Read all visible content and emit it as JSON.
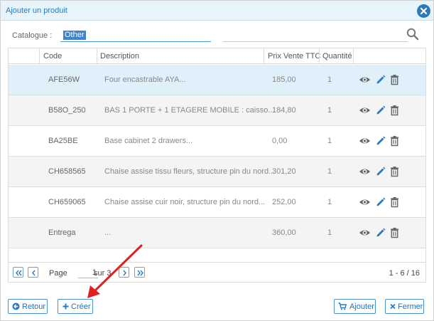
{
  "dialog": {
    "title": "Ajouter un produit"
  },
  "catalogue": {
    "label": "Catalogue :",
    "value": "Other"
  },
  "table": {
    "headers": {
      "code": "Code",
      "description": "Description",
      "price": "Prix Vente TTC",
      "qty": "Quantité"
    },
    "rows": [
      {
        "code": "AFE56W",
        "description": "Four encastrable AYA...",
        "price": "185,00",
        "qty": "1"
      },
      {
        "code": "B58O_250",
        "description": "BAS 1 PORTE + 1 ETAGERE MOBILE : caisso...",
        "price": "184,80",
        "qty": "1"
      },
      {
        "code": "BA25BE",
        "description": "Base cabinet 2 drawers...",
        "price": "0,00",
        "qty": "1"
      },
      {
        "code": "CH658565",
        "description": "Chaise assise tissu fleurs, structure pin du nord...",
        "price": "301,20",
        "qty": "1"
      },
      {
        "code": "CH659065",
        "description": "Chaise assise cuir noir, structure pin du nord...",
        "price": "252,00",
        "qty": "1"
      },
      {
        "code": "Entrega",
        "description": "...",
        "price": "360,00",
        "qty": "1"
      }
    ]
  },
  "pager": {
    "page_label": "Page",
    "page_value": "1",
    "of_label": "sur 3",
    "count": "1 - 6 / 16"
  },
  "buttons": {
    "back": "Retour",
    "create": "Créer",
    "add": "Ajouter",
    "close": "Fermer"
  },
  "icons": {
    "close": "close-icon",
    "search": "search-icon",
    "view": "eye-icon",
    "edit": "pencil-icon",
    "delete": "trash-icon",
    "first": "double-chevron-left-icon",
    "prev": "chevron-left-icon",
    "next": "chevron-right-icon",
    "last": "double-chevron-right-icon",
    "back": "arrow-circle-left-icon",
    "create": "plus-icon",
    "add": "cart-icon",
    "fermer": "x-icon"
  },
  "colors": {
    "accent": "#2b7bbf",
    "selected_row": "#dff0fb",
    "alt_row": "#f4f4f4",
    "annotation_arrow": "#e02020"
  }
}
